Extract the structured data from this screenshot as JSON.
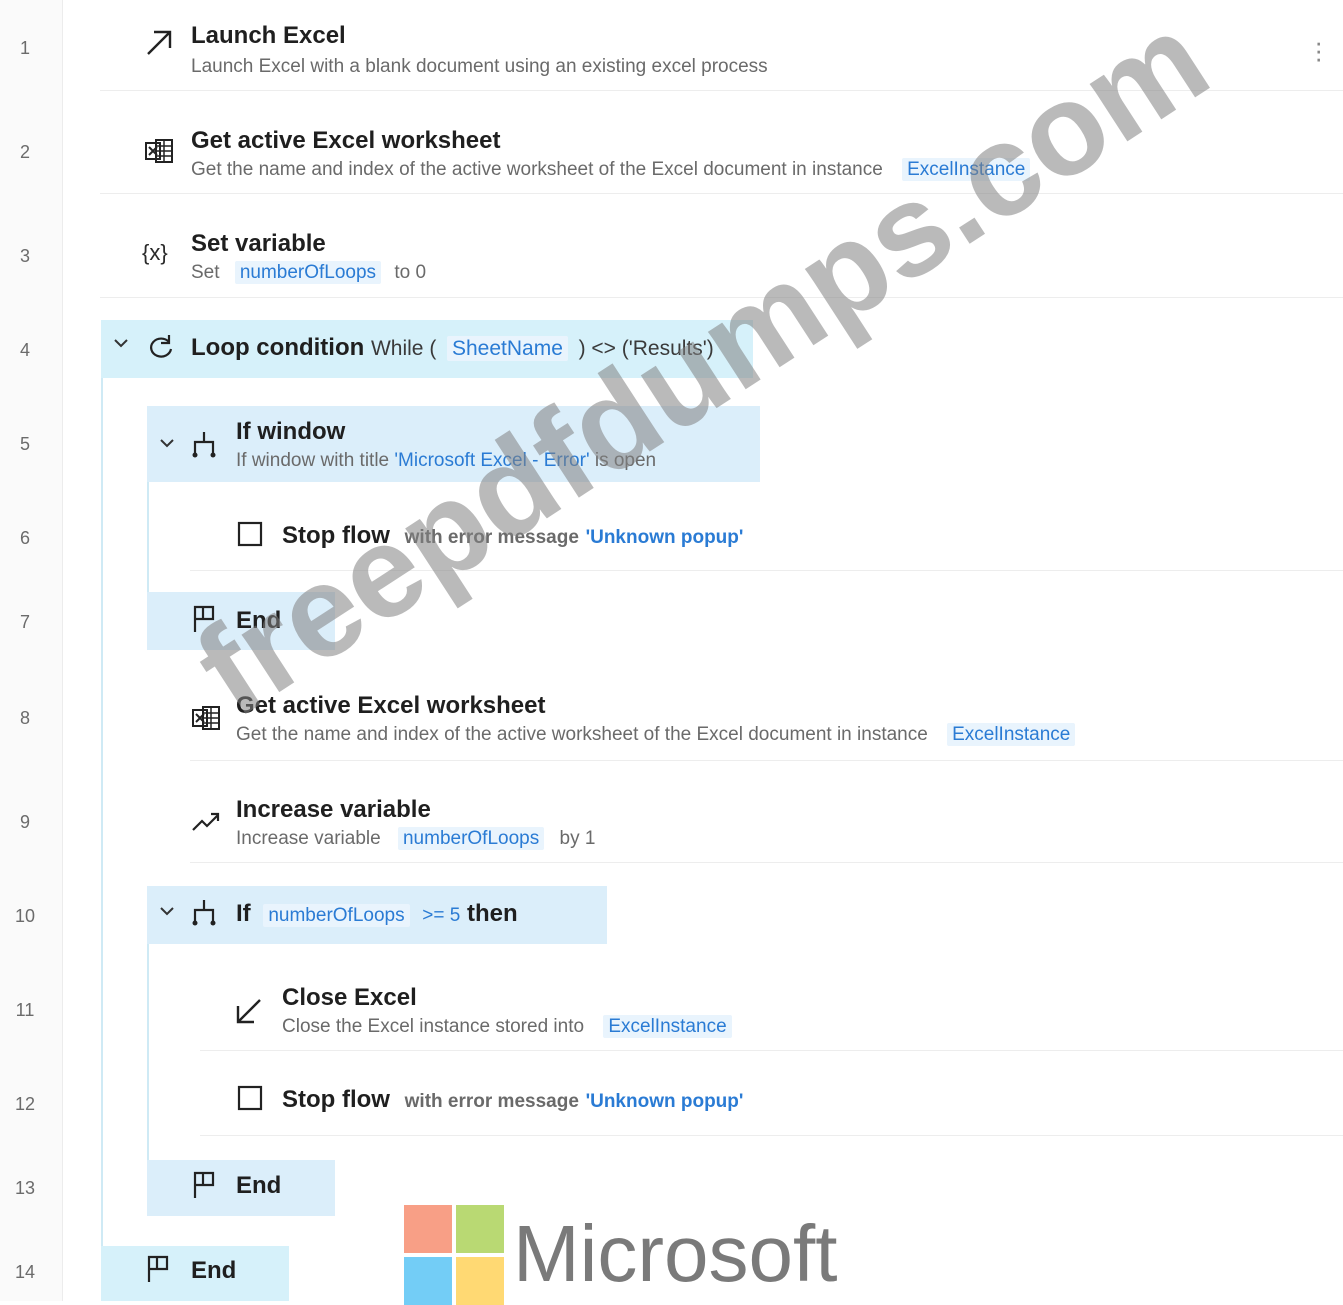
{
  "line_numbers": [
    "1",
    "2",
    "3",
    "4",
    "5",
    "6",
    "7",
    "8",
    "9",
    "10",
    "11",
    "12",
    "13",
    "14"
  ],
  "actions": {
    "launch_excel": {
      "title": "Launch Excel",
      "desc": "Launch Excel with a blank document using an existing excel process",
      "icon": "arrow-up-right-icon"
    },
    "get_worksheet_1": {
      "title": "Get active Excel worksheet",
      "desc": "Get the name and index of the active worksheet of the Excel document in instance",
      "var": "ExcelInstance",
      "icon": "excel-sheet-icon"
    },
    "set_variable": {
      "title": "Set variable",
      "desc_pre": "Set",
      "var": "numberOfLoops",
      "desc_post": "to 0",
      "icon": "variable-icon"
    },
    "loop_condition": {
      "title": "Loop condition",
      "pre": "While (",
      "var": "SheetName",
      "post": ") <> ('Results')",
      "icon": "loop-icon"
    },
    "if_window": {
      "title": "If window",
      "desc_pre": "If window with title",
      "str": "'Microsoft Excel - Error'",
      "desc_post": "is open",
      "icon": "branch-icon"
    },
    "stop_flow_1": {
      "title": "Stop flow",
      "desc_pre": "with error message",
      "str": "'Unknown popup'",
      "icon": "stop-square-icon"
    },
    "end_1": {
      "label": "End",
      "icon": "flag-icon"
    },
    "get_worksheet_2": {
      "title": "Get active Excel worksheet",
      "desc": "Get the name and index of the active worksheet of the Excel document in instance",
      "var": "ExcelInstance",
      "icon": "excel-sheet-icon"
    },
    "increase_variable": {
      "title": "Increase variable",
      "desc_pre": "Increase variable",
      "var": "numberOfLoops",
      "desc_post": "by 1",
      "icon": "trend-up-icon"
    },
    "if_loops": {
      "keyword": "If",
      "var": "numberOfLoops",
      "cond": ">= 5",
      "then": "then",
      "icon": "branch-icon"
    },
    "close_excel": {
      "title": "Close Excel",
      "desc": "Close the Excel instance stored into",
      "var": "ExcelInstance",
      "icon": "arrow-down-left-icon"
    },
    "stop_flow_2": {
      "title": "Stop flow",
      "desc_pre": "with error message",
      "str": "'Unknown popup'",
      "icon": "stop-square-icon"
    },
    "end_2": {
      "label": "End",
      "icon": "flag-icon"
    },
    "end_3": {
      "label": "End",
      "icon": "flag-icon"
    }
  },
  "watermark": "freepdfdumps.com",
  "brand": {
    "name": "Microsoft",
    "colors": [
      "#f25022",
      "#7fba00",
      "#00a4ef",
      "#ffb900"
    ]
  },
  "colors": {
    "block_highlight": "#d6f1fa",
    "variable_text": "#2a7bd4"
  }
}
